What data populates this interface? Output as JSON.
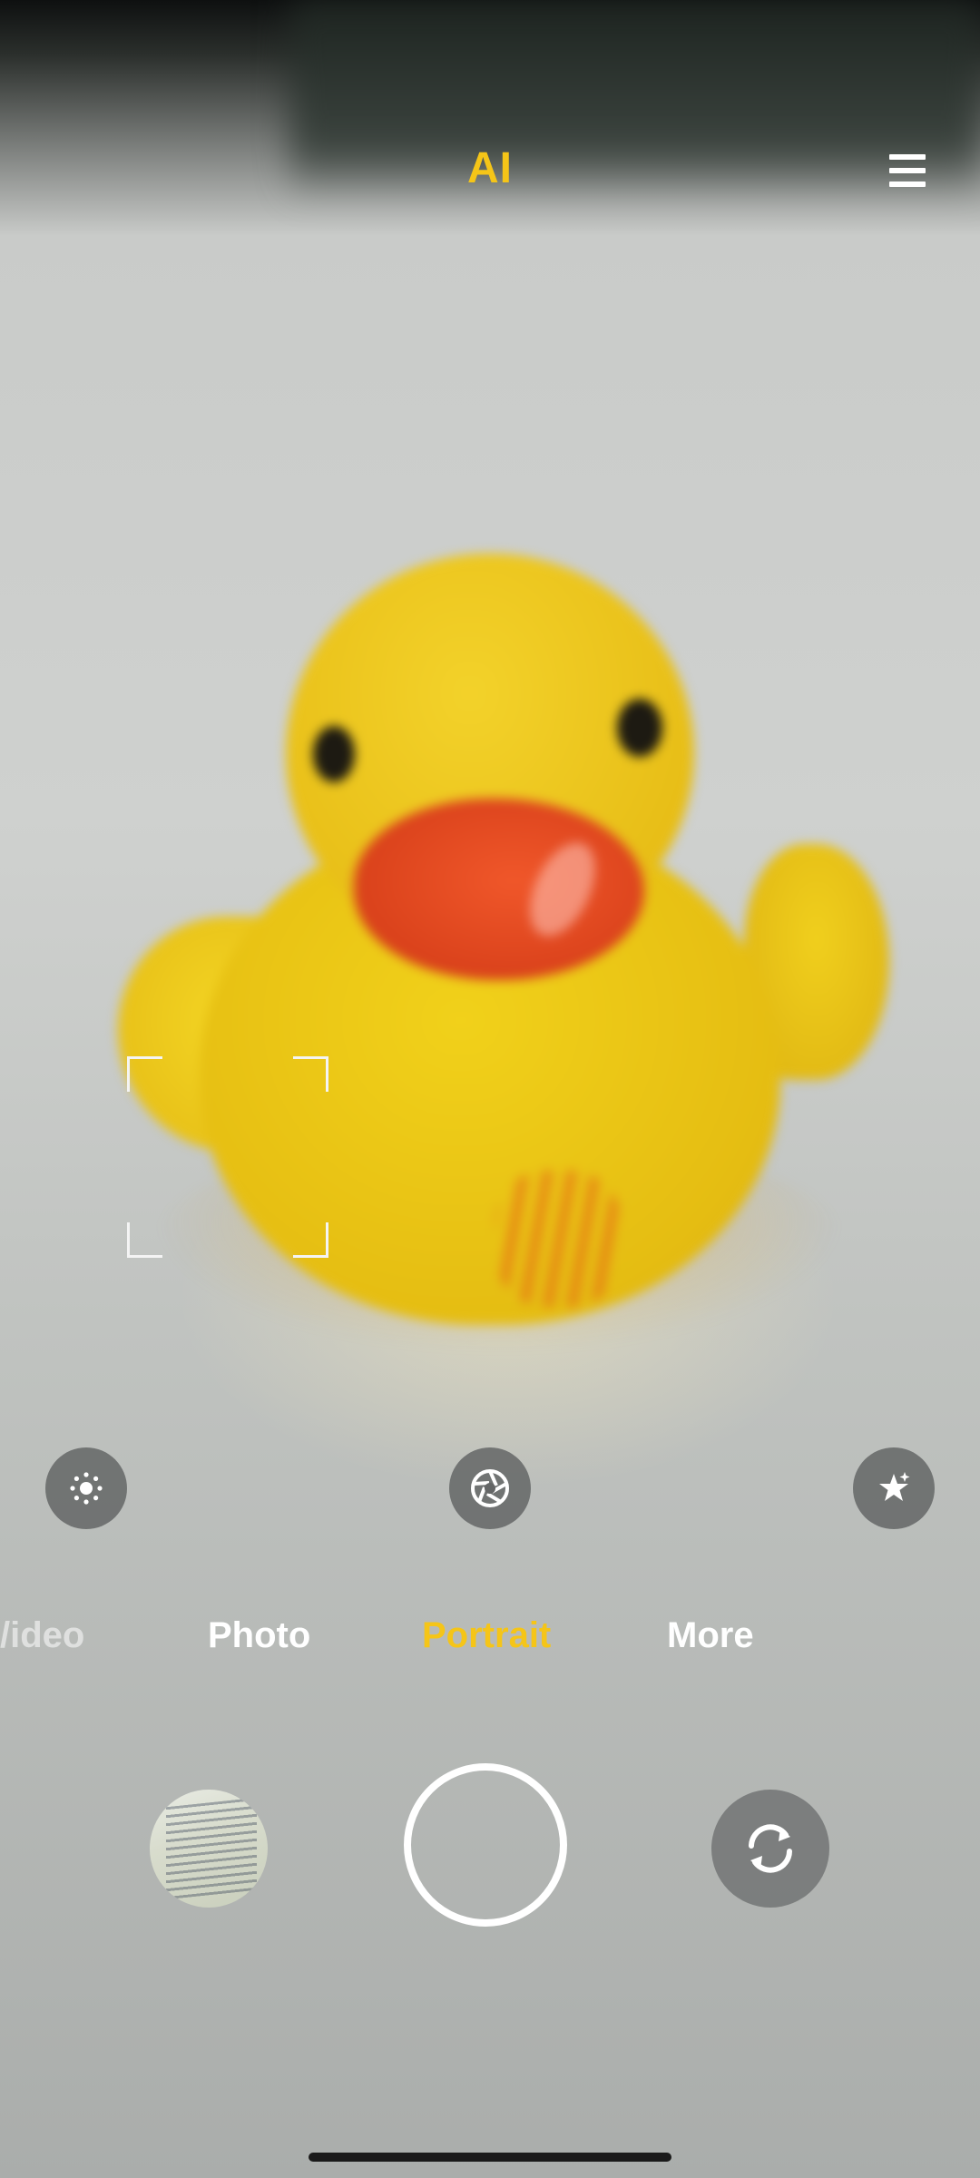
{
  "top_bar": {
    "ai_label": "AI",
    "menu_icon": "menu-icon"
  },
  "quick_toggles": [
    {
      "icon": "brightness-icon"
    },
    {
      "icon": "aperture-icon"
    },
    {
      "icon": "beautify-icon"
    }
  ],
  "modes": {
    "items": [
      {
        "label": "Video",
        "state": "partial"
      },
      {
        "label": "Photo",
        "state": "inactive"
      },
      {
        "label": "Portrait",
        "state": "active"
      },
      {
        "label": "More",
        "state": "inactive"
      }
    ],
    "selected": "Portrait",
    "video_visible_text": "/ideo"
  },
  "controls": {
    "gallery_icon": "gallery-thumbnail",
    "shutter_icon": "shutter-icon",
    "switch_icon": "switch-camera-icon"
  },
  "colors": {
    "accent": "#f5c518",
    "text": "#ffffff",
    "button_bg": "#646666"
  }
}
